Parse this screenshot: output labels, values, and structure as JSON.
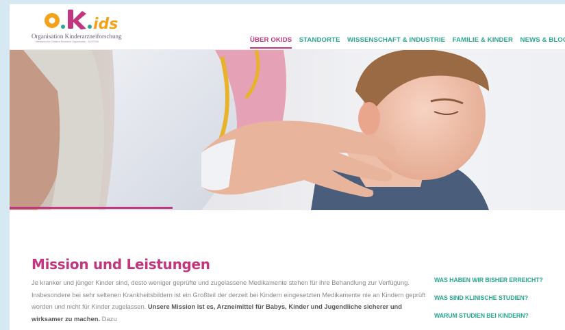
{
  "logo": {
    "mark_text": "o.k.ids",
    "title": "Organisation Kinderarzneiforschung",
    "subtitle": "Medicines for Children Research Organisation · AUSTRIA"
  },
  "nav": {
    "items": [
      {
        "label": "ÜBER OKIDS",
        "active": true
      },
      {
        "label": "STANDORTE",
        "active": false
      },
      {
        "label": "WISSENSCHAFT & INDUSTRIE",
        "active": false
      },
      {
        "label": "FAMILIE & KINDER",
        "active": false
      },
      {
        "label": "NEWS & BLOG",
        "active": false
      }
    ]
  },
  "hero": {
    "alt": "Ärztin tastet den Hals eines Jungen ab"
  },
  "main": {
    "title": "Mission und Leistungen",
    "intro_plain": "Je kranker und jünger Kinder sind, desto weniger geprüfte und zugelassene Medikamente stehen für ihre Behandlung zur Verfügung. Insbesondere bei sehr seltenen Krankheitsbildern ist ein Großteil der derzeit bei Kindern eingesetzten Medikamente nie an Kindern geprüft worden und nicht für Kinder zugelassen. ",
    "intro_bold": "Unsere Mission ist es, Arzneimittel für Babys, Kinder und Jugendliche sicherer und wirksamer zu machen.",
    "intro_tail": " Dazu"
  },
  "side_links": [
    {
      "label": "WAS HABEN WIR BISHER ERREICHT?"
    },
    {
      "label": "WAS SIND KLINISCHE STUDIEN?"
    },
    {
      "label": "WARUM STUDIEN BEI KINDERN?"
    }
  ],
  "colors": {
    "brand_pink": "#c2367f",
    "brand_green": "#29a68e",
    "logo_orange": "#f4a21c",
    "frame_blue": "#d6e8f1"
  }
}
